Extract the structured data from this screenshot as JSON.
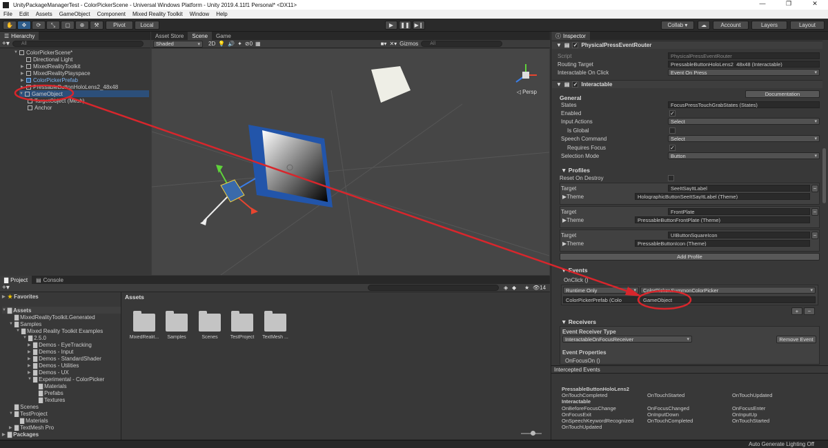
{
  "window": {
    "title": "UnityPackageManagerTest - ColorPickerScene - Universal Windows Platform - Unity 2019.4.11f1 Personal* <DX11>",
    "minimize": "—",
    "maximize": "❐",
    "close": "✕"
  },
  "menu": [
    "File",
    "Edit",
    "Assets",
    "GameObject",
    "Component",
    "Mixed Reality Toolkit",
    "Window",
    "Help"
  ],
  "toolbar": {
    "pivot": "Pivot",
    "local": "Local",
    "collab": "Collab ▾",
    "account": "Account",
    "layers": "Layers",
    "layout": "Layout"
  },
  "hierarchy": {
    "tab": "Hierarchy",
    "search_placeholder": "All",
    "scene": "ColorPickerScene*",
    "items": [
      {
        "label": "Directional Light"
      },
      {
        "label": "MixedRealityToolkit"
      },
      {
        "label": "MixedRealityPlayspace"
      },
      {
        "label": "ColorPickerPrefab"
      },
      {
        "label": "PressableButtonHoloLens2_48x48"
      },
      {
        "label": "GameObject"
      },
      {
        "label": "TargetObject (Mesh)"
      },
      {
        "label": "Anchor"
      }
    ]
  },
  "scene_tabs": {
    "asset_store": "Asset Store",
    "scene": "Scene",
    "game": "Game"
  },
  "scene_toolbar": {
    "shading": "Shaded",
    "mode_2d": "2D",
    "hidden_count": "0",
    "gizmos": "Gizmos",
    "search_placeholder": "All"
  },
  "scene_view": {
    "projection": "◁ Persp"
  },
  "project": {
    "tabs": {
      "project": "Project",
      "console": "Console"
    },
    "layer_count": "14",
    "tree": [
      {
        "label": "Favorites"
      },
      {
        "label": "Assets"
      },
      {
        "label": "MixedRealityToolkit.Generated"
      },
      {
        "label": "Samples"
      },
      {
        "label": "Mixed Reality Toolkit Examples"
      },
      {
        "label": "2.5.0"
      },
      {
        "label": "Demos - EyeTracking"
      },
      {
        "label": "Demos - Input"
      },
      {
        "label": "Demos - StandardShader"
      },
      {
        "label": "Demos - Utilities"
      },
      {
        "label": "Demos - UX"
      },
      {
        "label": "Experimental - ColorPicker"
      },
      {
        "label": "Materials"
      },
      {
        "label": "Prefabs"
      },
      {
        "label": "Textures"
      },
      {
        "label": "Scenes"
      },
      {
        "label": "TestProject"
      },
      {
        "label": "Materials"
      },
      {
        "label": "TextMesh Pro"
      },
      {
        "label": "Packages"
      }
    ],
    "breadcrumb": "Assets",
    "assets": [
      {
        "label": "MixedRealit..."
      },
      {
        "label": "Samples"
      },
      {
        "label": "Scenes"
      },
      {
        "label": "TestProject"
      },
      {
        "label": "TextMesh ..."
      }
    ]
  },
  "inspector": {
    "tab": "Inspector",
    "router": {
      "title": "PhysicalPressEventRouter",
      "script_label": "Script",
      "script_value": "PhysicalPressEventRouter",
      "routing_label": "Routing Target",
      "routing_value": "PressableButtonHoloLens2_48x48 (Interactable)",
      "click_label": "Interactable On Click",
      "click_value": "Event On Press"
    },
    "interactable": {
      "title": "Interactable",
      "documentation": "Documentation",
      "general": "General",
      "states_label": "States",
      "states_value": "FocusPressTouchGrabStates (States)",
      "enabled_label": "Enabled",
      "input_actions_label": "Input Actions",
      "input_actions_value": "Select",
      "is_global_label": "Is Global",
      "speech_label": "Speech Command",
      "speech_value": "Select",
      "requires_focus_label": "Requires Focus",
      "selection_mode_label": "Selection Mode",
      "selection_mode_value": "Button",
      "profiles": "Profiles",
      "reset_label": "Reset On Destroy",
      "target_label": "Target",
      "theme_label": "Theme",
      "profile_list": [
        {
          "target": "SeeItSayItLabel",
          "theme": "HolographicButtonSeeItSayItLabel (Theme)"
        },
        {
          "target": "FrontPlate",
          "theme": "PressableButtonFrontPlate (Theme)"
        },
        {
          "target": "UIButtonSquareIcon",
          "theme": "PressableButtonIcon (Theme)"
        }
      ],
      "add_profile": "Add Profile",
      "events": "Events",
      "onclick": "OnClick ()",
      "runtime": "Runtime Only",
      "method": "ColorPicker.SummonColorPicker",
      "object": "ColorPickerPrefab (Colo",
      "arg_object": "GameObject",
      "receivers": "Receivers",
      "receiver_type_label": "Event Receiver Type",
      "receiver_type_value": "InteractableOnFocusReceiver",
      "remove_event": "Remove Event",
      "event_props": "Event Properties",
      "onfocuson": "OnFocusOn ()"
    },
    "intercepted": {
      "title": "Intercepted Events",
      "object": "PressableButtonHoloLens2",
      "row1": [
        "OnTouchCompleted",
        "OnTouchStarted",
        "OnTouchUpdated"
      ],
      "group": "Interactable",
      "row2": [
        "OnBeforeFocusChange",
        "OnFocusChanged",
        "OnFocusEnter"
      ],
      "row3": [
        "OnFocusExit",
        "OnInputDown",
        "OnInputUp"
      ],
      "row4": [
        "OnSpeechKeywordRecognized",
        "OnTouchCompleted",
        "OnTouchStarted"
      ],
      "row5": [
        "OnTouchUpdated"
      ]
    }
  },
  "status": {
    "right": "Auto Generate Lighting Off"
  },
  "colors": {
    "annotation": "#d8262c",
    "selection": "#2c4f7a",
    "link": "#7cb4f3"
  }
}
